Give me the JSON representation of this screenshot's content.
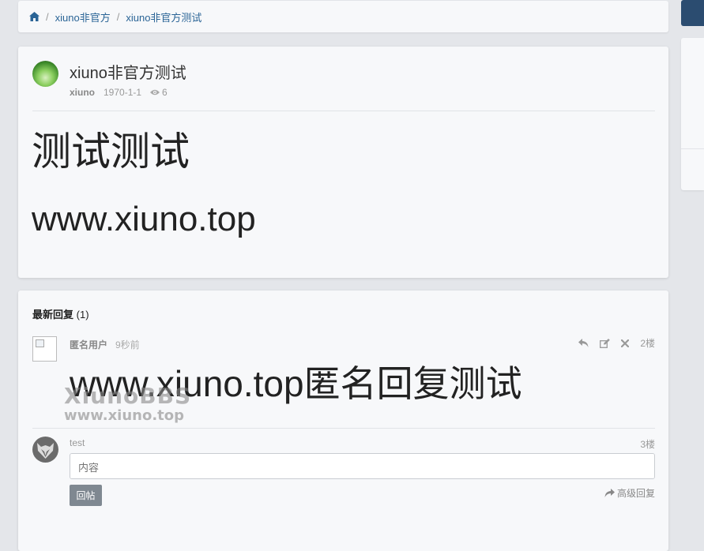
{
  "breadcrumb": {
    "home_icon": "home-icon",
    "items": [
      "xiuno非官方",
      "xiuno非官方测试"
    ]
  },
  "post": {
    "title": "xiuno非官方测试",
    "author": "xiuno",
    "date": "1970-1-1",
    "views": "6",
    "content": [
      "测试测试",
      "www.xiuno.top"
    ]
  },
  "replies": {
    "header_label": "最新回复",
    "header_count": "(1)",
    "items": [
      {
        "user": "匿名用户",
        "time": "9秒前",
        "floor": "2楼",
        "content": "www.xiuno.top匿名回复测试",
        "actions": [
          "reply-icon",
          "edit-icon",
          "delete-icon"
        ]
      }
    ]
  },
  "watermark": {
    "line1": "XiunoBBS",
    "line2": "www.xiuno.top"
  },
  "reply_form": {
    "user": "test",
    "floor": "3楼",
    "placeholder": "内容",
    "submit_label": "回帖",
    "advanced_label": "高级回复"
  },
  "colors": {
    "link": "#2a6496",
    "primary_dark": "#2b4c70",
    "button_gray": "#7f8891",
    "background": "#e4e6ea"
  }
}
